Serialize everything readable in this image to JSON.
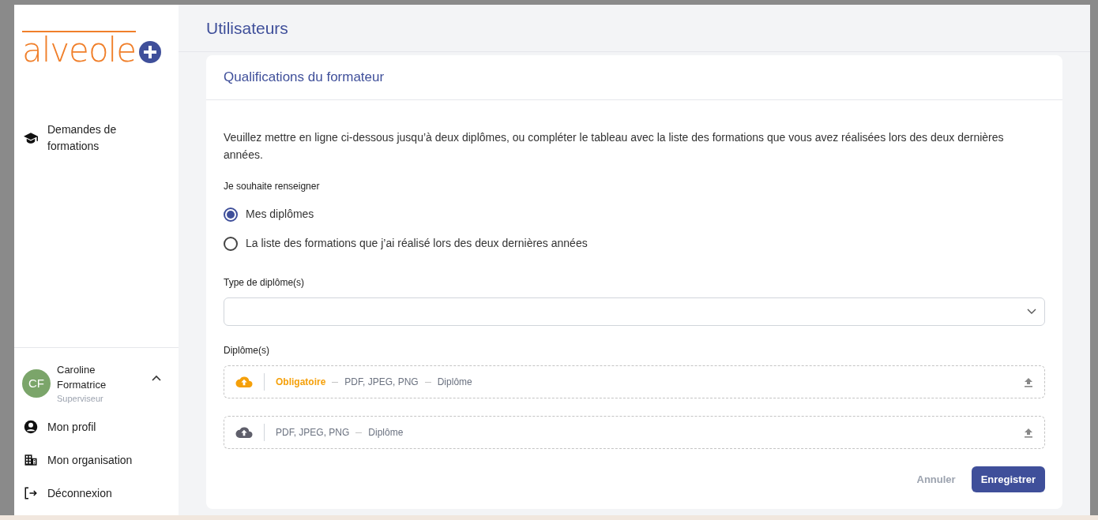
{
  "logo": {
    "text": "alveole"
  },
  "sidebar": {
    "nav": [
      {
        "label": "Demandes de formations",
        "kind": "cap"
      }
    ],
    "user": {
      "initials": "CF",
      "name": "Caroline Formatrice",
      "role": "Superviseur",
      "expanded": true
    },
    "menu": [
      {
        "label": "Mon profil",
        "kind": "profile"
      },
      {
        "label": "Mon organisation",
        "kind": "building"
      },
      {
        "label": "Déconnexion",
        "kind": "logout"
      }
    ]
  },
  "page_title": "Utilisateurs",
  "card": {
    "title": "Qualifications du formateur",
    "intro": "Veuillez mettre en ligne ci-dessous jusqu’à deux diplômes, ou compléter le tableau avec la liste des formations que vous avez réalisées lors des deux dernières années.",
    "choice_label": "Je souhaite renseigner",
    "options": [
      {
        "label": "Mes diplômes",
        "selected": true
      },
      {
        "label": "La liste des formations que j’ai réalisé lors des deux dernières années",
        "selected": false
      }
    ],
    "type_label": "Type de diplôme(s)",
    "files_label": "Diplôme(s)",
    "uploads": [
      {
        "required": true,
        "required_text": "Obligatoire",
        "formats": "PDF, JPEG, PNG",
        "name": "Diplôme"
      },
      {
        "required": false,
        "formats": "PDF, JPEG, PNG",
        "name": "Diplôme"
      }
    ],
    "cancel": "Annuler",
    "save": "Enregistrer"
  }
}
